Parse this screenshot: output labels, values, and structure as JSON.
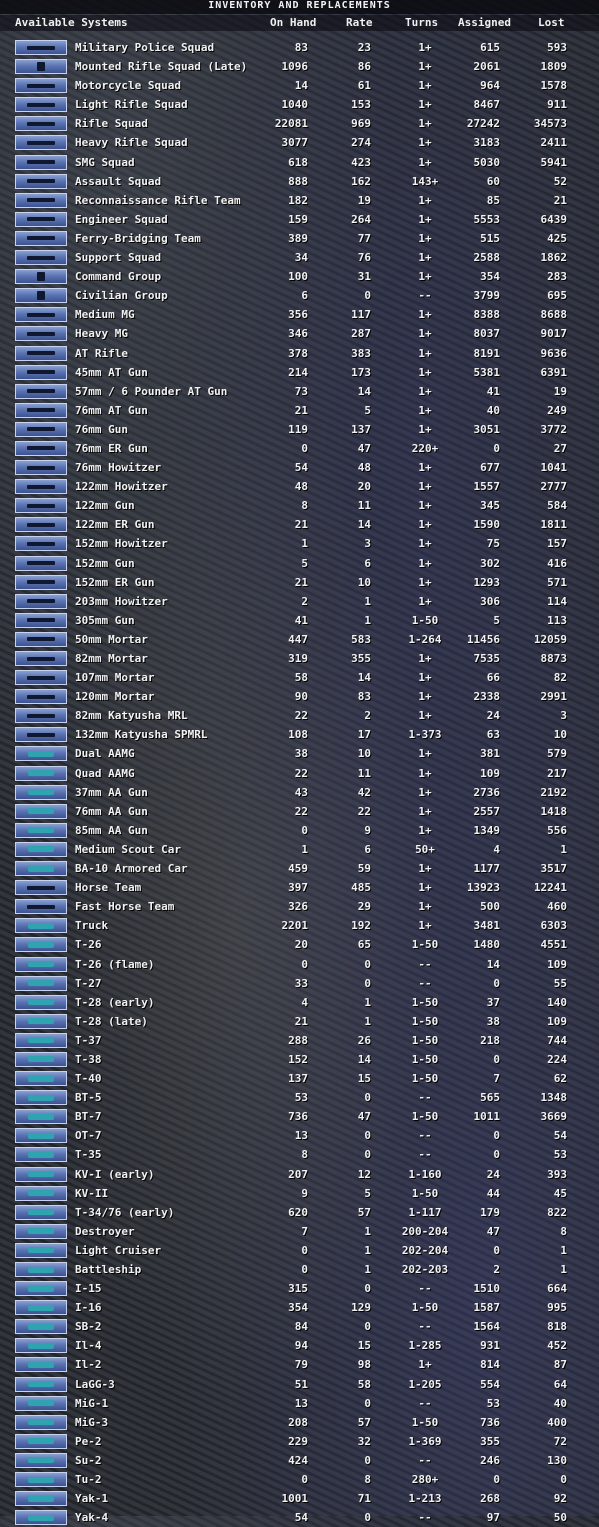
{
  "title": "INVENTORY AND REPLACEMENTS",
  "headers": {
    "systems": "Available Systems",
    "on_hand": "On Hand",
    "rate": "Rate",
    "turns": "Turns",
    "assigned": "Assigned",
    "lost": "Lost"
  },
  "rows": [
    {
      "name": "Military Police Squad",
      "on_hand": "83",
      "rate": "23",
      "turns": "1+",
      "assigned": "615",
      "lost": "593",
      "icon": "rifle-icon"
    },
    {
      "name": "Mounted Rifle Squad (Late)",
      "on_hand": "1096",
      "rate": "86",
      "turns": "1+",
      "assigned": "2061",
      "lost": "1809",
      "icon": "cavalry-icon"
    },
    {
      "name": "Motorcycle Squad",
      "on_hand": "14",
      "rate": "61",
      "turns": "1+",
      "assigned": "964",
      "lost": "1578",
      "icon": "rifle-icon"
    },
    {
      "name": "Light Rifle Squad",
      "on_hand": "1040",
      "rate": "153",
      "turns": "1+",
      "assigned": "8467",
      "lost": "911",
      "icon": "rifle-icon"
    },
    {
      "name": "Rifle Squad",
      "on_hand": "22081",
      "rate": "969",
      "turns": "1+",
      "assigned": "27242",
      "lost": "34573",
      "icon": "rifle-icon"
    },
    {
      "name": "Heavy Rifle Squad",
      "on_hand": "3077",
      "rate": "274",
      "turns": "1+",
      "assigned": "3183",
      "lost": "2411",
      "icon": "rifle-icon"
    },
    {
      "name": "SMG Squad",
      "on_hand": "618",
      "rate": "423",
      "turns": "1+",
      "assigned": "5030",
      "lost": "5941",
      "icon": "smg-icon"
    },
    {
      "name": "Assault Squad",
      "on_hand": "888",
      "rate": "162",
      "turns": "143+",
      "assigned": "60",
      "lost": "52",
      "icon": "smg-icon"
    },
    {
      "name": "Reconnaissance Rifle Team",
      "on_hand": "182",
      "rate": "19",
      "turns": "1+",
      "assigned": "85",
      "lost": "21",
      "icon": "rifle-icon"
    },
    {
      "name": "Engineer Squad",
      "on_hand": "159",
      "rate": "264",
      "turns": "1+",
      "assigned": "5553",
      "lost": "6439",
      "icon": "rifle-icon"
    },
    {
      "name": "Ferry-Bridging Team",
      "on_hand": "389",
      "rate": "77",
      "turns": "1+",
      "assigned": "515",
      "lost": "425",
      "icon": "rifle-icon"
    },
    {
      "name": "Support Squad",
      "on_hand": "34",
      "rate": "76",
      "turns": "1+",
      "assigned": "2588",
      "lost": "1862",
      "icon": "rifle-icon"
    },
    {
      "name": "Command Group",
      "on_hand": "100",
      "rate": "31",
      "turns": "1+",
      "assigned": "354",
      "lost": "283",
      "icon": "soldier-icon"
    },
    {
      "name": "Civilian Group",
      "on_hand": "6",
      "rate": "0",
      "turns": "--",
      "assigned": "3799",
      "lost": "695",
      "icon": "soldier-icon"
    },
    {
      "name": "Medium MG",
      "on_hand": "356",
      "rate": "117",
      "turns": "1+",
      "assigned": "8388",
      "lost": "8688",
      "icon": "machine-gun-icon"
    },
    {
      "name": "Heavy MG",
      "on_hand": "346",
      "rate": "287",
      "turns": "1+",
      "assigned": "8037",
      "lost": "9017",
      "icon": "machine-gun-icon"
    },
    {
      "name": "AT Rifle",
      "on_hand": "378",
      "rate": "383",
      "turns": "1+",
      "assigned": "8191",
      "lost": "9636",
      "icon": "rifle-icon"
    },
    {
      "name": "45mm AT Gun",
      "on_hand": "214",
      "rate": "173",
      "turns": "1+",
      "assigned": "5381",
      "lost": "6391",
      "icon": "gun-icon"
    },
    {
      "name": "57mm / 6 Pounder AT Gun",
      "on_hand": "73",
      "rate": "14",
      "turns": "1+",
      "assigned": "41",
      "lost": "19",
      "icon": "gun-icon"
    },
    {
      "name": "76mm AT Gun",
      "on_hand": "21",
      "rate": "5",
      "turns": "1+",
      "assigned": "40",
      "lost": "249",
      "icon": "gun-icon"
    },
    {
      "name": "76mm Gun",
      "on_hand": "119",
      "rate": "137",
      "turns": "1+",
      "assigned": "3051",
      "lost": "3772",
      "icon": "gun-icon"
    },
    {
      "name": "76mm ER Gun",
      "on_hand": "0",
      "rate": "47",
      "turns": "220+",
      "assigned": "0",
      "lost": "27",
      "icon": "gun-icon"
    },
    {
      "name": "76mm Howitzer",
      "on_hand": "54",
      "rate": "48",
      "turns": "1+",
      "assigned": "677",
      "lost": "1041",
      "icon": "gun-icon"
    },
    {
      "name": "122mm Howitzer",
      "on_hand": "48",
      "rate": "20",
      "turns": "1+",
      "assigned": "1557",
      "lost": "2777",
      "icon": "gun-icon"
    },
    {
      "name": "122mm Gun",
      "on_hand": "8",
      "rate": "11",
      "turns": "1+",
      "assigned": "345",
      "lost": "584",
      "icon": "gun-icon"
    },
    {
      "name": "122mm ER Gun",
      "on_hand": "21",
      "rate": "14",
      "turns": "1+",
      "assigned": "1590",
      "lost": "1811",
      "icon": "gun-icon"
    },
    {
      "name": "152mm Howitzer",
      "on_hand": "1",
      "rate": "3",
      "turns": "1+",
      "assigned": "75",
      "lost": "157",
      "icon": "gun-icon"
    },
    {
      "name": "152mm Gun",
      "on_hand": "5",
      "rate": "6",
      "turns": "1+",
      "assigned": "302",
      "lost": "416",
      "icon": "gun-icon"
    },
    {
      "name": "152mm ER Gun",
      "on_hand": "21",
      "rate": "10",
      "turns": "1+",
      "assigned": "1293",
      "lost": "571",
      "icon": "gun-icon"
    },
    {
      "name": "203mm Howitzer",
      "on_hand": "2",
      "rate": "1",
      "turns": "1+",
      "assigned": "306",
      "lost": "114",
      "icon": "gun-icon"
    },
    {
      "name": "305mm Gun",
      "on_hand": "41",
      "rate": "1",
      "turns": "1-50",
      "assigned": "5",
      "lost": "113",
      "icon": "gun-icon"
    },
    {
      "name": "50mm Mortar",
      "on_hand": "447",
      "rate": "583",
      "turns": "1-264",
      "assigned": "11456",
      "lost": "12059",
      "icon": "mortar-icon"
    },
    {
      "name": "82mm Mortar",
      "on_hand": "319",
      "rate": "355",
      "turns": "1+",
      "assigned": "7535",
      "lost": "8873",
      "icon": "mortar-icon"
    },
    {
      "name": "107mm Mortar",
      "on_hand": "58",
      "rate": "14",
      "turns": "1+",
      "assigned": "66",
      "lost": "82",
      "icon": "mortar-icon"
    },
    {
      "name": "120mm Mortar",
      "on_hand": "90",
      "rate": "83",
      "turns": "1+",
      "assigned": "2338",
      "lost": "2991",
      "icon": "mortar-icon"
    },
    {
      "name": "82mm Katyusha MRL",
      "on_hand": "22",
      "rate": "2",
      "turns": "1+",
      "assigned": "24",
      "lost": "3",
      "icon": "rocket-launcher-icon"
    },
    {
      "name": "132mm Katyusha SPMRL",
      "on_hand": "108",
      "rate": "17",
      "turns": "1-373",
      "assigned": "63",
      "lost": "10",
      "icon": "rocket-launcher-icon"
    },
    {
      "name": "Dual AAMG",
      "on_hand": "38",
      "rate": "10",
      "turns": "1+",
      "assigned": "381",
      "lost": "579",
      "icon": "aa-gun-icon"
    },
    {
      "name": "Quad AAMG",
      "on_hand": "22",
      "rate": "11",
      "turns": "1+",
      "assigned": "109",
      "lost": "217",
      "icon": "aa-gun-icon"
    },
    {
      "name": "37mm AA Gun",
      "on_hand": "43",
      "rate": "42",
      "turns": "1+",
      "assigned": "2736",
      "lost": "2192",
      "icon": "aa-gun-icon"
    },
    {
      "name": "76mm AA Gun",
      "on_hand": "22",
      "rate": "22",
      "turns": "1+",
      "assigned": "2557",
      "lost": "1418",
      "icon": "aa-gun-icon"
    },
    {
      "name": "85mm AA Gun",
      "on_hand": "0",
      "rate": "9",
      "turns": "1+",
      "assigned": "1349",
      "lost": "556",
      "icon": "aa-gun-icon"
    },
    {
      "name": "Medium Scout Car",
      "on_hand": "1",
      "rate": "6",
      "turns": "50+",
      "assigned": "4",
      "lost": "1",
      "icon": "armored-car-icon"
    },
    {
      "name": "BA-10 Armored Car",
      "on_hand": "459",
      "rate": "59",
      "turns": "1+",
      "assigned": "1177",
      "lost": "3517",
      "icon": "armored-car-icon"
    },
    {
      "name": "Horse Team",
      "on_hand": "397",
      "rate": "485",
      "turns": "1+",
      "assigned": "13923",
      "lost": "12241",
      "icon": "horse-icon"
    },
    {
      "name": "Fast Horse Team",
      "on_hand": "326",
      "rate": "29",
      "turns": "1+",
      "assigned": "500",
      "lost": "460",
      "icon": "horse-icon"
    },
    {
      "name": "Truck",
      "on_hand": "2201",
      "rate": "192",
      "turns": "1+",
      "assigned": "3481",
      "lost": "6303",
      "icon": "truck-icon"
    },
    {
      "name": "T-26",
      "on_hand": "20",
      "rate": "65",
      "turns": "1-50",
      "assigned": "1480",
      "lost": "4551",
      "icon": "tank-icon"
    },
    {
      "name": "T-26 (flame)",
      "on_hand": "0",
      "rate": "0",
      "turns": "--",
      "assigned": "14",
      "lost": "109",
      "icon": "tank-icon"
    },
    {
      "name": "T-27",
      "on_hand": "33",
      "rate": "0",
      "turns": "--",
      "assigned": "0",
      "lost": "55",
      "icon": "tank-icon"
    },
    {
      "name": "T-28 (early)",
      "on_hand": "4",
      "rate": "1",
      "turns": "1-50",
      "assigned": "37",
      "lost": "140",
      "icon": "tank-icon"
    },
    {
      "name": "T-28 (late)",
      "on_hand": "21",
      "rate": "1",
      "turns": "1-50",
      "assigned": "38",
      "lost": "109",
      "icon": "tank-icon"
    },
    {
      "name": "T-37",
      "on_hand": "288",
      "rate": "26",
      "turns": "1-50",
      "assigned": "218",
      "lost": "744",
      "icon": "tank-icon"
    },
    {
      "name": "T-38",
      "on_hand": "152",
      "rate": "14",
      "turns": "1-50",
      "assigned": "0",
      "lost": "224",
      "icon": "tank-icon"
    },
    {
      "name": "T-40",
      "on_hand": "137",
      "rate": "15",
      "turns": "1-50",
      "assigned": "7",
      "lost": "62",
      "icon": "tank-icon"
    },
    {
      "name": "BT-5",
      "on_hand": "53",
      "rate": "0",
      "turns": "--",
      "assigned": "565",
      "lost": "1348",
      "icon": "tank-icon"
    },
    {
      "name": "BT-7",
      "on_hand": "736",
      "rate": "47",
      "turns": "1-50",
      "assigned": "1011",
      "lost": "3669",
      "icon": "tank-icon"
    },
    {
      "name": "OT-7",
      "on_hand": "13",
      "rate": "0",
      "turns": "--",
      "assigned": "0",
      "lost": "54",
      "icon": "tank-icon"
    },
    {
      "name": "T-35",
      "on_hand": "8",
      "rate": "0",
      "turns": "--",
      "assigned": "0",
      "lost": "53",
      "icon": "tank-icon"
    },
    {
      "name": "KV-I (early)",
      "on_hand": "207",
      "rate": "12",
      "turns": "1-160",
      "assigned": "24",
      "lost": "393",
      "icon": "tank-icon"
    },
    {
      "name": "KV-II",
      "on_hand": "9",
      "rate": "5",
      "turns": "1-50",
      "assigned": "44",
      "lost": "45",
      "icon": "tank-icon"
    },
    {
      "name": "T-34/76 (early)",
      "on_hand": "620",
      "rate": "57",
      "turns": "1-117",
      "assigned": "179",
      "lost": "822",
      "icon": "tank-icon"
    },
    {
      "name": "Destroyer",
      "on_hand": "7",
      "rate": "1",
      "turns": "200-204",
      "assigned": "47",
      "lost": "8",
      "icon": "ship-icon"
    },
    {
      "name": "Light Cruiser",
      "on_hand": "0",
      "rate": "1",
      "turns": "202-204",
      "assigned": "0",
      "lost": "1",
      "icon": "ship-icon"
    },
    {
      "name": "Battleship",
      "on_hand": "0",
      "rate": "1",
      "turns": "202-203",
      "assigned": "2",
      "lost": "1",
      "icon": "ship-icon"
    },
    {
      "name": "I-15",
      "on_hand": "315",
      "rate": "0",
      "turns": "--",
      "assigned": "1510",
      "lost": "664",
      "icon": "aircraft-icon"
    },
    {
      "name": "I-16",
      "on_hand": "354",
      "rate": "129",
      "turns": "1-50",
      "assigned": "1587",
      "lost": "995",
      "icon": "aircraft-icon"
    },
    {
      "name": "SB-2",
      "on_hand": "84",
      "rate": "0",
      "turns": "--",
      "assigned": "1564",
      "lost": "818",
      "icon": "aircraft-icon"
    },
    {
      "name": "Il-4",
      "on_hand": "94",
      "rate": "15",
      "turns": "1-285",
      "assigned": "931",
      "lost": "452",
      "icon": "aircraft-icon"
    },
    {
      "name": "Il-2",
      "on_hand": "79",
      "rate": "98",
      "turns": "1+",
      "assigned": "814",
      "lost": "87",
      "icon": "aircraft-icon"
    },
    {
      "name": "LaGG-3",
      "on_hand": "51",
      "rate": "58",
      "turns": "1-205",
      "assigned": "554",
      "lost": "64",
      "icon": "aircraft-icon"
    },
    {
      "name": "MiG-1",
      "on_hand": "13",
      "rate": "0",
      "turns": "--",
      "assigned": "53",
      "lost": "40",
      "icon": "aircraft-icon"
    },
    {
      "name": "MiG-3",
      "on_hand": "208",
      "rate": "57",
      "turns": "1-50",
      "assigned": "736",
      "lost": "400",
      "icon": "aircraft-icon"
    },
    {
      "name": "Pe-2",
      "on_hand": "229",
      "rate": "32",
      "turns": "1-369",
      "assigned": "355",
      "lost": "72",
      "icon": "aircraft-icon"
    },
    {
      "name": "Su-2",
      "on_hand": "424",
      "rate": "0",
      "turns": "--",
      "assigned": "246",
      "lost": "130",
      "icon": "aircraft-icon"
    },
    {
      "name": "Tu-2",
      "on_hand": "0",
      "rate": "8",
      "turns": "280+",
      "assigned": "0",
      "lost": "0",
      "icon": "aircraft-icon"
    },
    {
      "name": "Yak-1",
      "on_hand": "1001",
      "rate": "71",
      "turns": "1-213",
      "assigned": "268",
      "lost": "92",
      "icon": "aircraft-icon"
    },
    {
      "name": "Yak-4",
      "on_hand": "54",
      "rate": "0",
      "turns": "--",
      "assigned": "97",
      "lost": "50",
      "icon": "aircraft-icon"
    }
  ]
}
